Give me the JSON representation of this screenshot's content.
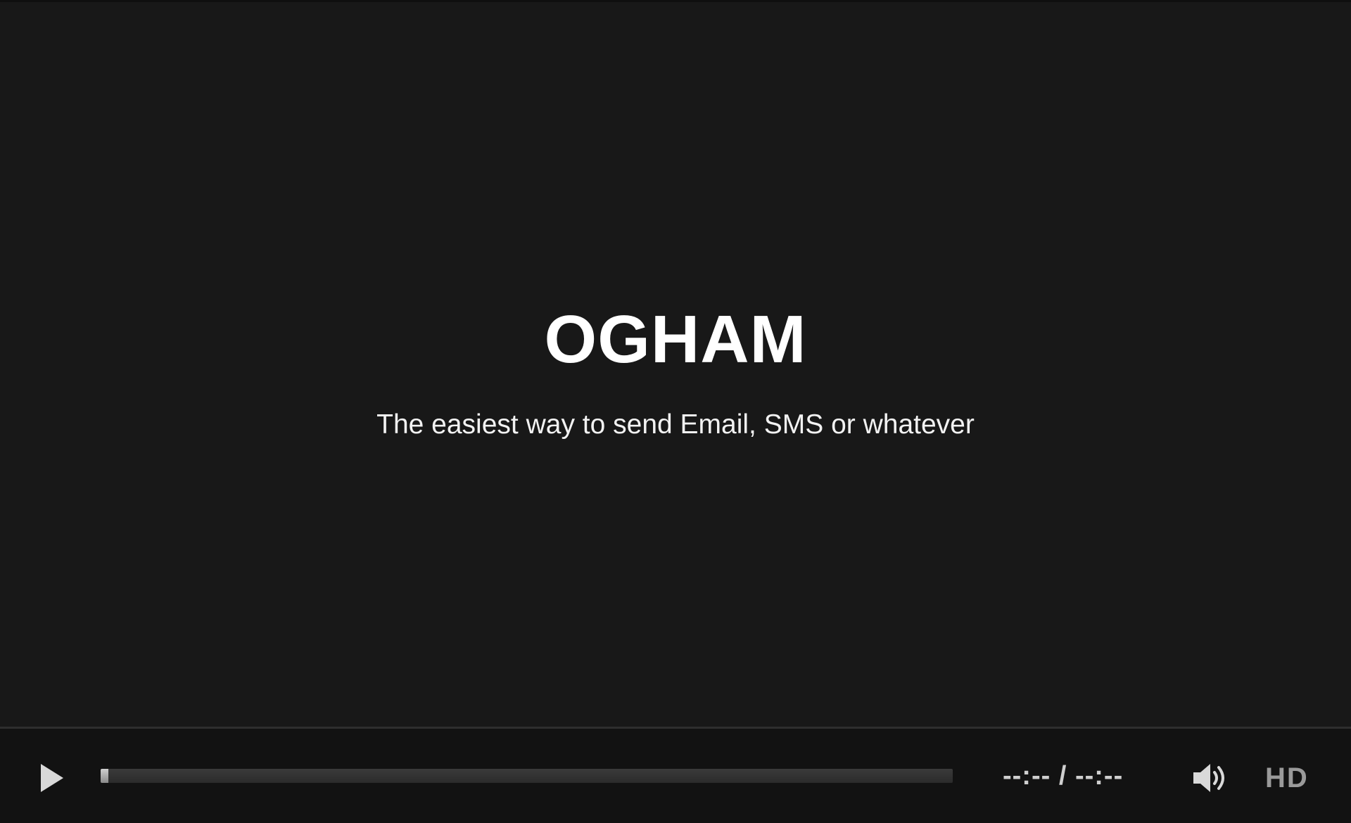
{
  "video": {
    "title": "OGHAM",
    "subtitle": "The easiest way to send Email, SMS or whatever"
  },
  "controls": {
    "play_icon": "play-icon",
    "progress": 0.009,
    "time_current": "--:--",
    "time_separator": "/",
    "time_total": "--:--",
    "volume_icon": "volume-icon",
    "quality_label": "HD"
  },
  "colors": {
    "background": "#181818",
    "control_bar": "#121212",
    "text": "#ffffff",
    "control_text": "#cfcfcf",
    "hd_text": "#9a9a9a"
  }
}
